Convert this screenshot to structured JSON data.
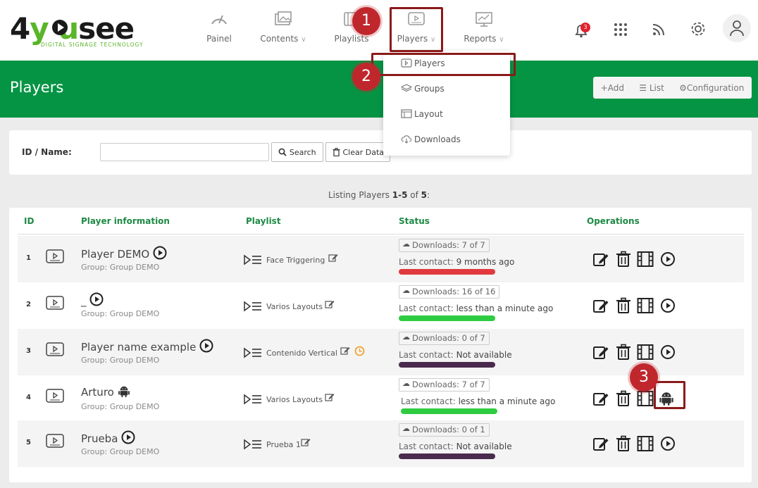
{
  "logo": {
    "main": "4yousee",
    "sub": "DIGITAL SIGNAGE TECHNOLOGY"
  },
  "nav": [
    {
      "label": "Painel",
      "icon": "gauge-icon",
      "chevron": ""
    },
    {
      "label": "Contents",
      "icon": "images-icon",
      "chevron": "∨"
    },
    {
      "label": "Playlists",
      "icon": "playlist-icon",
      "chevron": ""
    },
    {
      "label": "Players",
      "icon": "player-screen-icon",
      "chevron": "∨"
    },
    {
      "label": "Reports",
      "icon": "chart-monitor-icon",
      "chevron": "∨"
    }
  ],
  "notifications": {
    "count": "3"
  },
  "page_title": "Players",
  "actions": {
    "add": "Add",
    "list": "List",
    "configuration": "Configuration"
  },
  "dropdown": [
    {
      "label": "Players",
      "icon": "player-screen-icon"
    },
    {
      "label": "Groups",
      "icon": "layers-icon"
    },
    {
      "label": "Layout",
      "icon": "layout-icon"
    },
    {
      "label": "Downloads",
      "icon": "cloud-download-icon"
    }
  ],
  "callouts": [
    "1",
    "2",
    "3"
  ],
  "search": {
    "label": "ID / Name:",
    "value": "",
    "search_btn": "Search",
    "clear_btn": "Clear Data"
  },
  "listing": {
    "prefix": "Listing Players ",
    "range": "1-5",
    "of": " of ",
    "total": "5",
    "suffix": ":"
  },
  "table": {
    "headers": {
      "id": "ID",
      "info": "Player information",
      "playlist": "Playlist",
      "status": "Status",
      "ops": "Operations"
    },
    "rows": [
      {
        "id": "1",
        "name": "Player DEMO",
        "group_label": "Group:",
        "group": "Group DEMO",
        "playlist": "Face Triggering",
        "downloads": "Downloads: 7 of 7",
        "contact_label": "Last contact:",
        "contact": "9 months ago",
        "status_color": "#e03a3e",
        "name_icon": "play-circle-icon",
        "last_op": "play-circle-icon"
      },
      {
        "id": "2",
        "name": "_",
        "group_label": "Group:",
        "group": "Group DEMO",
        "playlist": "Varios Layouts",
        "downloads": "Downloads: 16 of 16",
        "contact_label": "Last contact:",
        "contact": "less than a minute ago",
        "status_color": "#2ecc40",
        "name_icon": "play-circle-icon",
        "last_op": "play-circle-icon"
      },
      {
        "id": "3",
        "name": "Player name example",
        "group_label": "Group:",
        "group": "Group DEMO",
        "playlist": "Contenido Vertical",
        "downloads": "Downloads: 0 of 7",
        "contact_label": "Last contact:",
        "contact": "Not available",
        "status_color": "#4a2a4e",
        "name_icon": "play-circle-icon",
        "last_op": "play-circle-icon"
      },
      {
        "id": "4",
        "name": "Arturo",
        "group_label": "Group:",
        "group": "Group DEMO",
        "playlist": "Varios Layouts",
        "downloads": "Downloads: 7 of 7",
        "contact_label": "Last contact:",
        "contact": "less than a minute ago",
        "status_color": "#2ecc40",
        "name_icon": "android-icon",
        "last_op": "android-icon"
      },
      {
        "id": "5",
        "name": "Prueba",
        "group_label": "Group:",
        "group": "Group DEMO",
        "playlist": "Prueba 1",
        "downloads": "Downloads: 0 of 1",
        "contact_label": "Last contact:",
        "contact": "Not available",
        "status_color": "#4a2a4e",
        "name_icon": "play-circle-icon",
        "last_op": "play-circle-icon"
      }
    ]
  },
  "colors": {
    "brand_green": "#049444",
    "header_green": "#1d8a44",
    "callout_red": "#c0272d",
    "highlight_border": "#8b1a1a"
  }
}
